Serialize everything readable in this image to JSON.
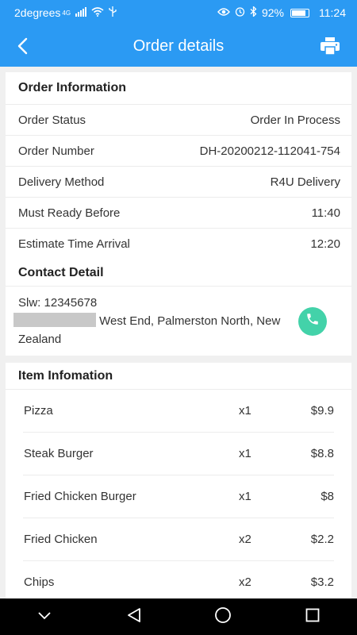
{
  "status_bar": {
    "carrier": "2degrees",
    "network": "4G",
    "battery": "92%",
    "time": "11:24"
  },
  "header": {
    "title": "Order details",
    "back_icon": "back-chevron-icon",
    "print_icon": "print-icon"
  },
  "order_info": {
    "heading": "Order Information",
    "rows": [
      {
        "label": "Order Status",
        "value": "Order In Process"
      },
      {
        "label": "Order Number",
        "value": "DH-20200212-112041-754"
      },
      {
        "label": "Delivery Method",
        "value": "R4U Delivery"
      },
      {
        "label": "Must Ready Before",
        "value": "11:40"
      },
      {
        "label": "Estimate Time Arrival",
        "value": "12:20"
      }
    ]
  },
  "contact": {
    "heading": "Contact Detail",
    "name_line": "Slw: 12345678",
    "address_tail": "West End, Palmerston North, New",
    "address_last": "Zealand",
    "call_icon": "phone-icon",
    "call_color": "#43d2a9"
  },
  "items": {
    "heading": "Item Infomation",
    "list": [
      {
        "name": "Pizza",
        "qty": "x1",
        "price": "$9.9"
      },
      {
        "name": "Steak Burger",
        "qty": "x1",
        "price": "$8.8"
      },
      {
        "name": "Fried Chicken Burger",
        "qty": "x1",
        "price": "$8"
      },
      {
        "name": "Fried Chicken",
        "qty": "x2",
        "price": "$2.2"
      },
      {
        "name": "Chips",
        "qty": "x2",
        "price": "$3.2"
      }
    ]
  },
  "colors": {
    "accent": "#2b9af3",
    "background": "#f0f0f0"
  }
}
